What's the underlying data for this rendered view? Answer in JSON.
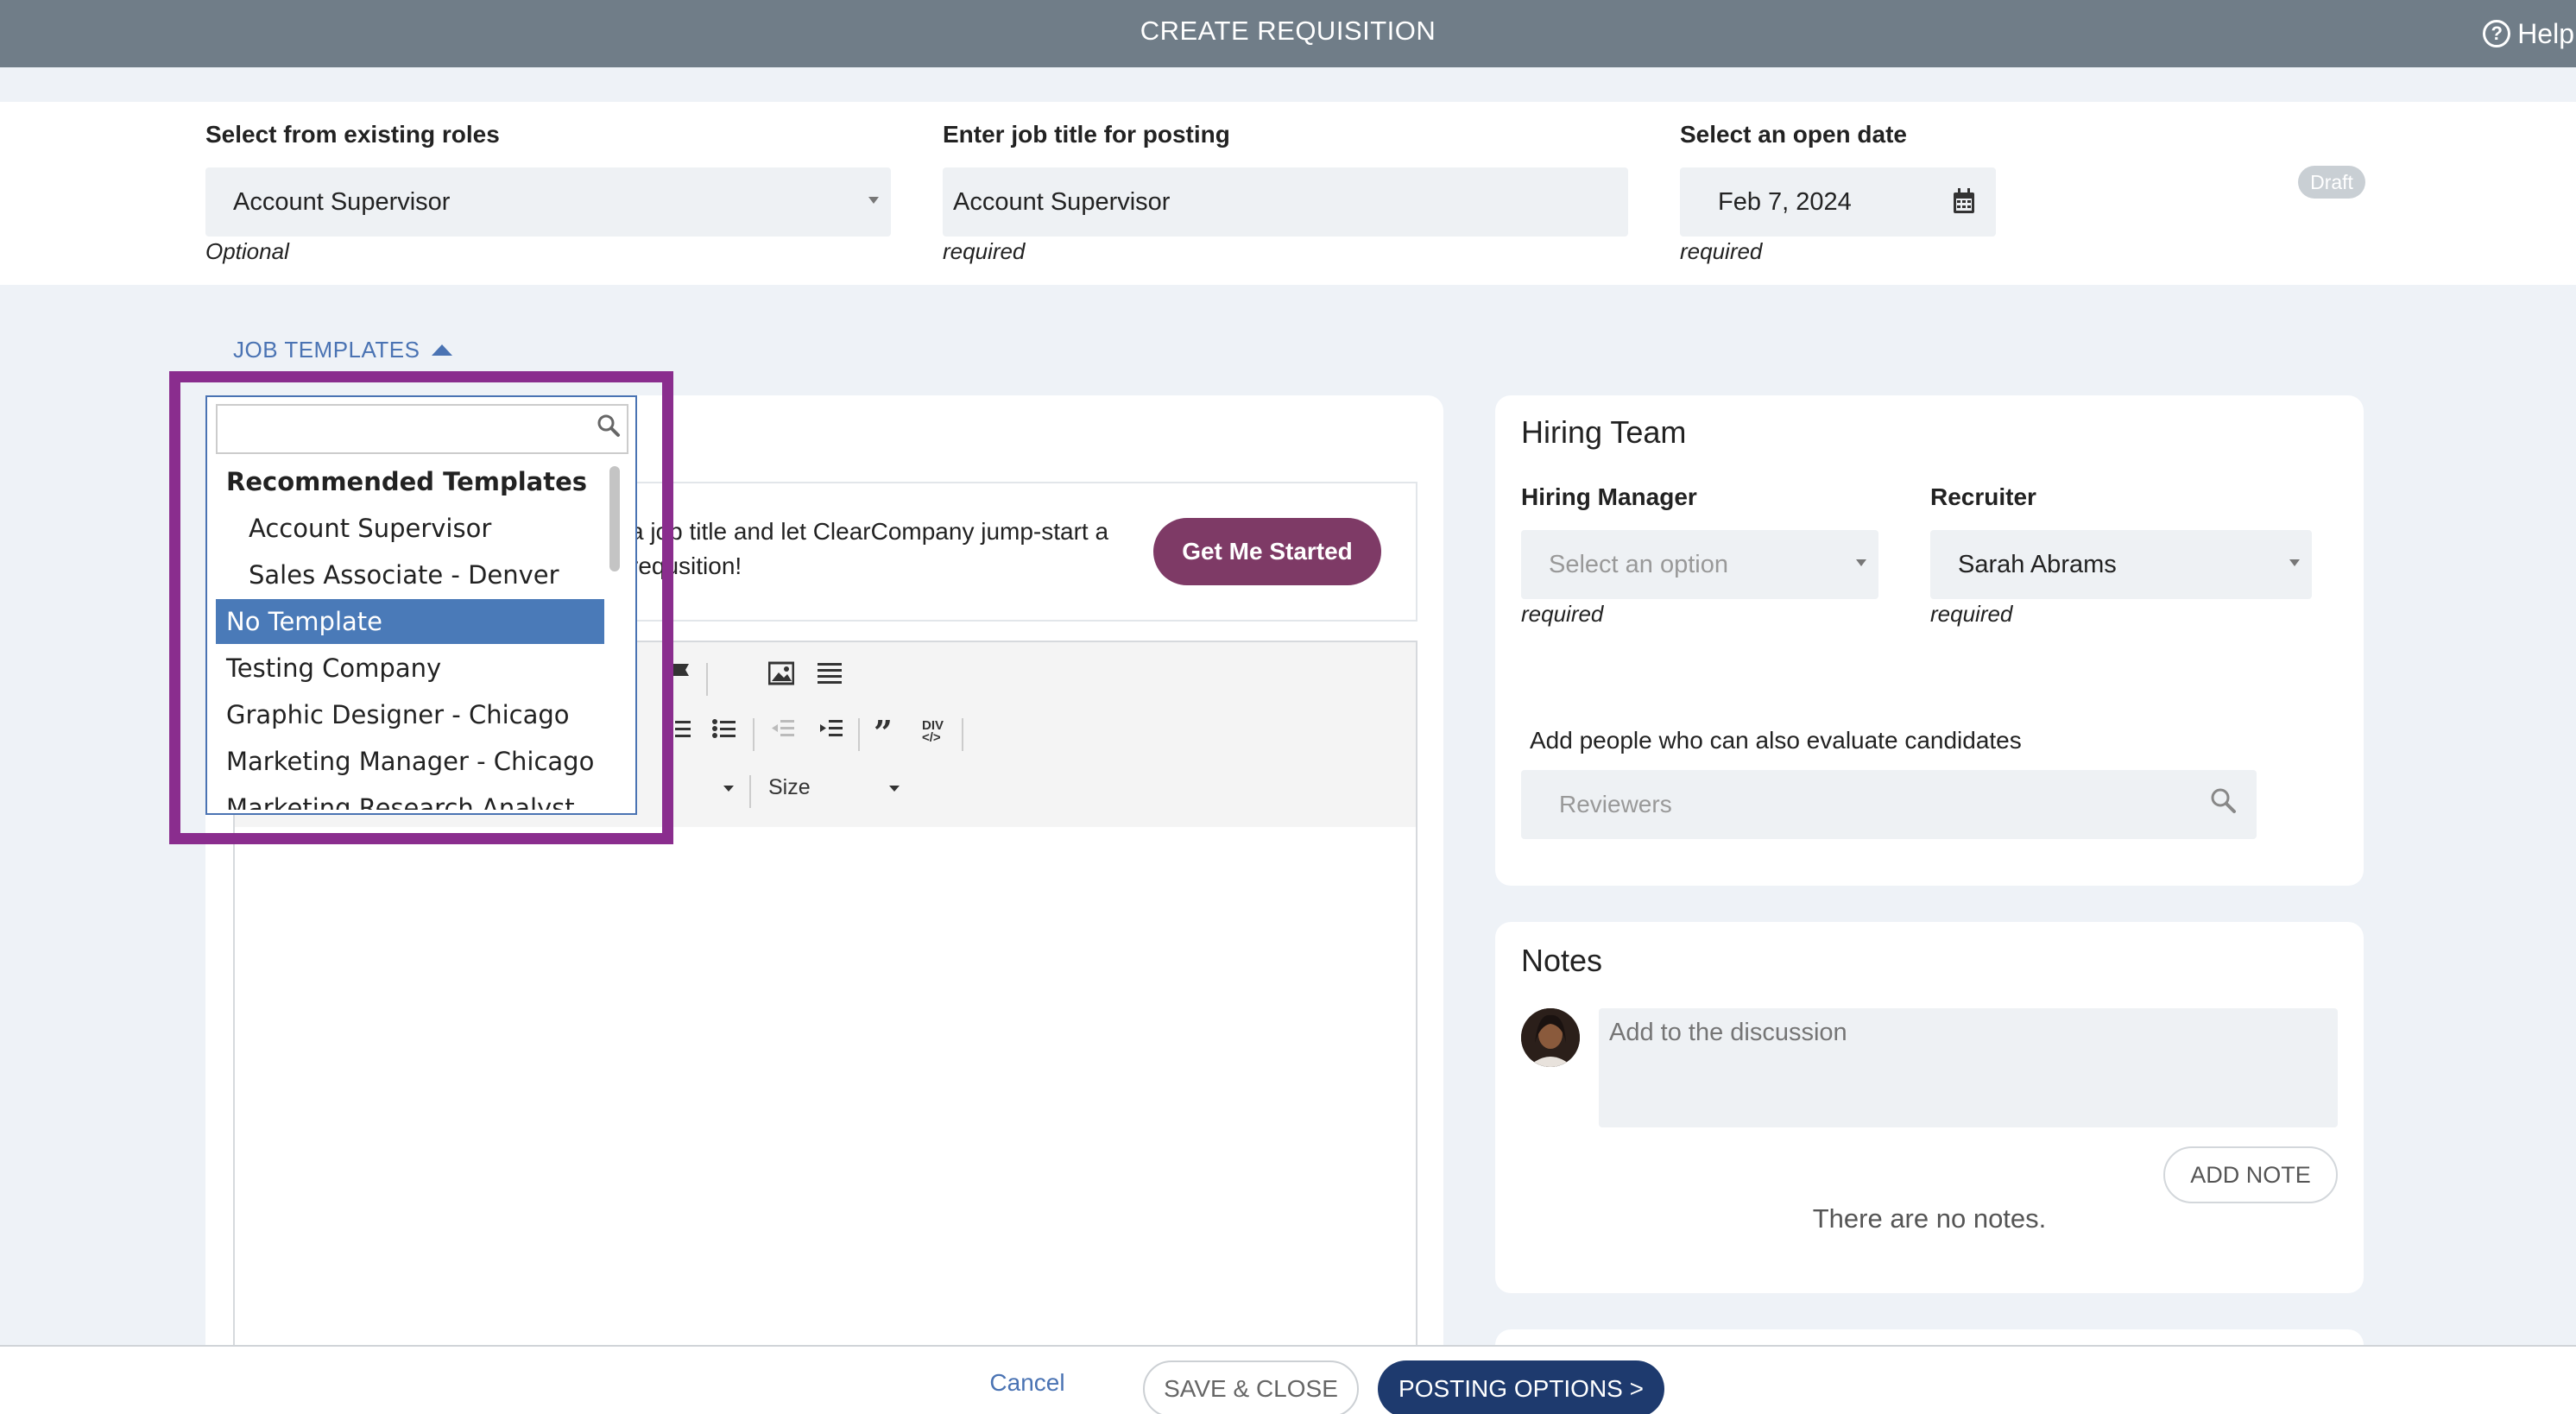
{
  "header": {
    "title": "CREATE REQUISITION",
    "help_label": "Help",
    "help_icon": "question-circle-icon"
  },
  "top_fields": {
    "existing_role": {
      "label": "Select from existing roles",
      "value": "Account Supervisor",
      "hint": "Optional"
    },
    "job_title": {
      "label": "Enter job title for posting",
      "value": "Account Supervisor",
      "hint": "required"
    },
    "open_date": {
      "label": "Select an open date",
      "value": "Feb 7, 2024",
      "hint": "required",
      "icon": "calendar-icon"
    },
    "status_badge": "Draft"
  },
  "job_templates": {
    "toggle_label": "JOB TEMPLATES",
    "search_placeholder": "",
    "items": [
      {
        "kind": "group",
        "label": "Recommended Templates"
      },
      {
        "kind": "child",
        "label": "Account Supervisor"
      },
      {
        "kind": "child",
        "label": "Sales Associate - Denver HQ"
      },
      {
        "kind": "option",
        "label": "No Template",
        "selected": true
      },
      {
        "kind": "option",
        "label": "Testing Company"
      },
      {
        "kind": "option",
        "label": "Graphic Designer - Chicago"
      },
      {
        "kind": "option",
        "label": "Marketing Manager - Chicago"
      },
      {
        "kind": "option",
        "label": "Marketing Research Analyst"
      }
    ]
  },
  "banner": {
    "text": "a job title and let ClearCompany jump-start a requsition!",
    "button": "Get Me Started"
  },
  "editor": {
    "size_label": "Size"
  },
  "hiring_team": {
    "title": "Hiring Team",
    "hiring_manager": {
      "label": "Hiring Manager",
      "placeholder": "Select an option",
      "hint": "required"
    },
    "recruiter": {
      "label": "Recruiter",
      "value": "Sarah Abrams",
      "hint": "required"
    },
    "reviewers_label": "Add people who can also evaluate candidates",
    "reviewers_placeholder": "Reviewers"
  },
  "notes": {
    "title": "Notes",
    "placeholder": "Add to the discussion",
    "add_button": "ADD NOTE",
    "empty_text": "There are no notes."
  },
  "footer": {
    "cancel": "Cancel",
    "save_close": "SAVE & CLOSE",
    "posting_options": "POSTING OPTIONS >"
  },
  "colors": {
    "header_bg": "#707d88",
    "accent_blue": "#4a73b3",
    "brand_purple": "#7e3a66",
    "highlight": "#8a2d8e",
    "primary_button": "#1e3a6e"
  }
}
